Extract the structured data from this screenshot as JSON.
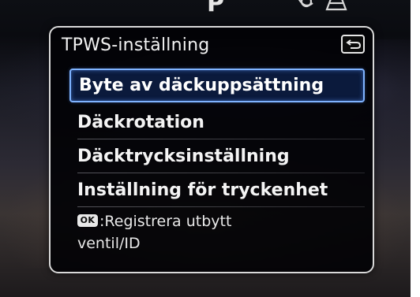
{
  "status_bar": {
    "gear": "P",
    "tire_warning_icon": "tire-pressure-warning-icon"
  },
  "panel": {
    "title": "TPWS-inställning",
    "back_icon": "return-arrow-icon"
  },
  "menu": {
    "items": [
      {
        "label": "Byte av däckuppsättning",
        "selected": true
      },
      {
        "label": "Däckrotation",
        "selected": false
      },
      {
        "label": "Däcktrycksinställning",
        "selected": false
      },
      {
        "label": "Inställning för tryckenhet",
        "selected": false
      }
    ]
  },
  "hint": {
    "button": "OK",
    "line1": ":Registrera utbytt",
    "line2": "ventil/ID"
  },
  "colors": {
    "selection_border": "#7fb3ff",
    "selection_fill": "#0b1a3c",
    "panel_border": "#d9d9d9"
  }
}
